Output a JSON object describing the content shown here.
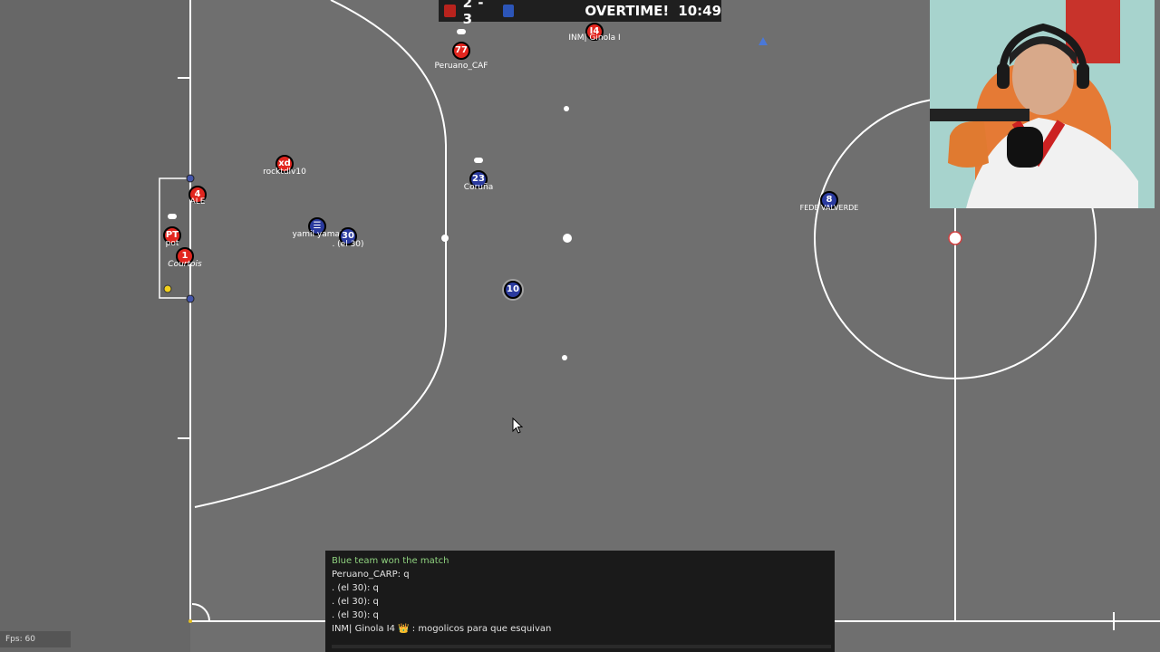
{
  "scoreboard": {
    "red_score": "2",
    "blue_score": "3",
    "score_text": "2 - 3",
    "status": "OVERTIME!",
    "time": "10:49",
    "colors": {
      "red": "#b8231d",
      "blue": "#2c55b8"
    }
  },
  "players": [
    {
      "number": "77",
      "name": "Peruano_CAF",
      "team": "red",
      "chat_bubble": true
    },
    {
      "number": "I4",
      "name": "INM| Ginola I",
      "team": "red",
      "chat_bubble": false
    },
    {
      "number": "xd",
      "name": "rocktdlv10",
      "team": "red",
      "chat_bubble": false
    },
    {
      "number": "23",
      "name": "Coruña",
      "team": "blue",
      "chat_bubble": true
    },
    {
      "number": "4",
      "name": "ALE",
      "team": "red",
      "chat_bubble": false
    },
    {
      "number": "PT",
      "name": "pot",
      "team": "red",
      "chat_bubble": true
    },
    {
      "number": "1",
      "name": "Courtois",
      "team": "red",
      "chat_bubble": false
    },
    {
      "number": "☰",
      "name": "yamil yamal",
      "team": "blue",
      "chat_bubble": false
    },
    {
      "number": "30",
      "name": ". (el 30)",
      "team": "blue",
      "chat_bubble": false
    },
    {
      "number": "8",
      "name": "FEDE VALVERDE",
      "team": "blue",
      "chat_bubble": false
    }
  ],
  "ball": {
    "number": "10"
  },
  "chat": {
    "messages": [
      {
        "text": "Blue team won the match",
        "type": "system"
      },
      {
        "text": "Peruano_CARP: q",
        "type": "user"
      },
      {
        "text": ". (el 30): q",
        "type": "user"
      },
      {
        "text": ". (el 30): q",
        "type": "user"
      },
      {
        "text": ". (el 30): q",
        "type": "user"
      },
      {
        "text": "INM| Ginola I4 👑 : mogolicos para que esquivan",
        "type": "user"
      }
    ]
  },
  "fps": "Fps: 60",
  "icons": {
    "cursor": "mouse-pointer-icon",
    "chat_bubble": "chat-bubble-icon",
    "team_marker": "square-icon"
  }
}
